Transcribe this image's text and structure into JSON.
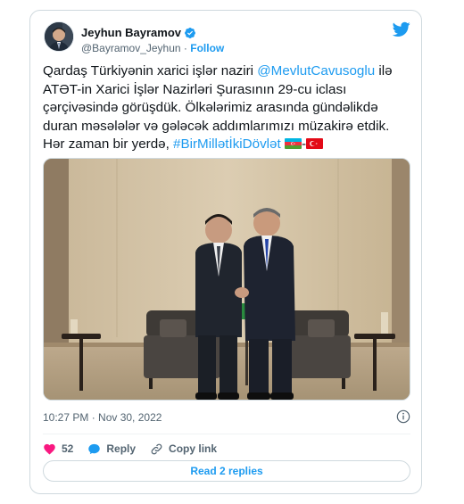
{
  "author": {
    "display_name": "Jeyhun Bayramov",
    "handle": "@Bayramov_Jeyhun",
    "separator": "·",
    "follow_label": "Follow"
  },
  "tweet": {
    "text_1": "Qardaş Türkiyənin xarici işlər naziri ",
    "mention": "@MevlutCavusoglu",
    "text_2": " ilə\nATƏT-in Xarici İşlər Nazirləri Şurasının 29-cu iclası\nçərçivəsində görüşdük. Ölkələrimiz arasında gündəlikdə\nduran məsələlər və gələcək addımlarımızı müzakirə etdik.\nHər zaman bir yerdə, ",
    "hashtag": "#BirMillətİkiDövlət",
    "flag_separator": "-"
  },
  "timestamp": "10:27 PM · Nov 30, 2022",
  "actions": {
    "likes_count": "52",
    "reply_label": "Reply",
    "copy_link_label": "Copy link"
  },
  "read_replies_label": "Read 2 replies",
  "colors": {
    "accent": "#1d9bf0",
    "like": "#f91880",
    "text": "#0f1419",
    "muted": "#536471",
    "border": "#cfd9de"
  },
  "icons": {
    "verified": "verified-badge-icon",
    "twitter": "twitter-bird-icon",
    "info": "info-icon",
    "like": "heart-icon",
    "reply": "speech-bubble-icon",
    "copy": "link-icon"
  }
}
